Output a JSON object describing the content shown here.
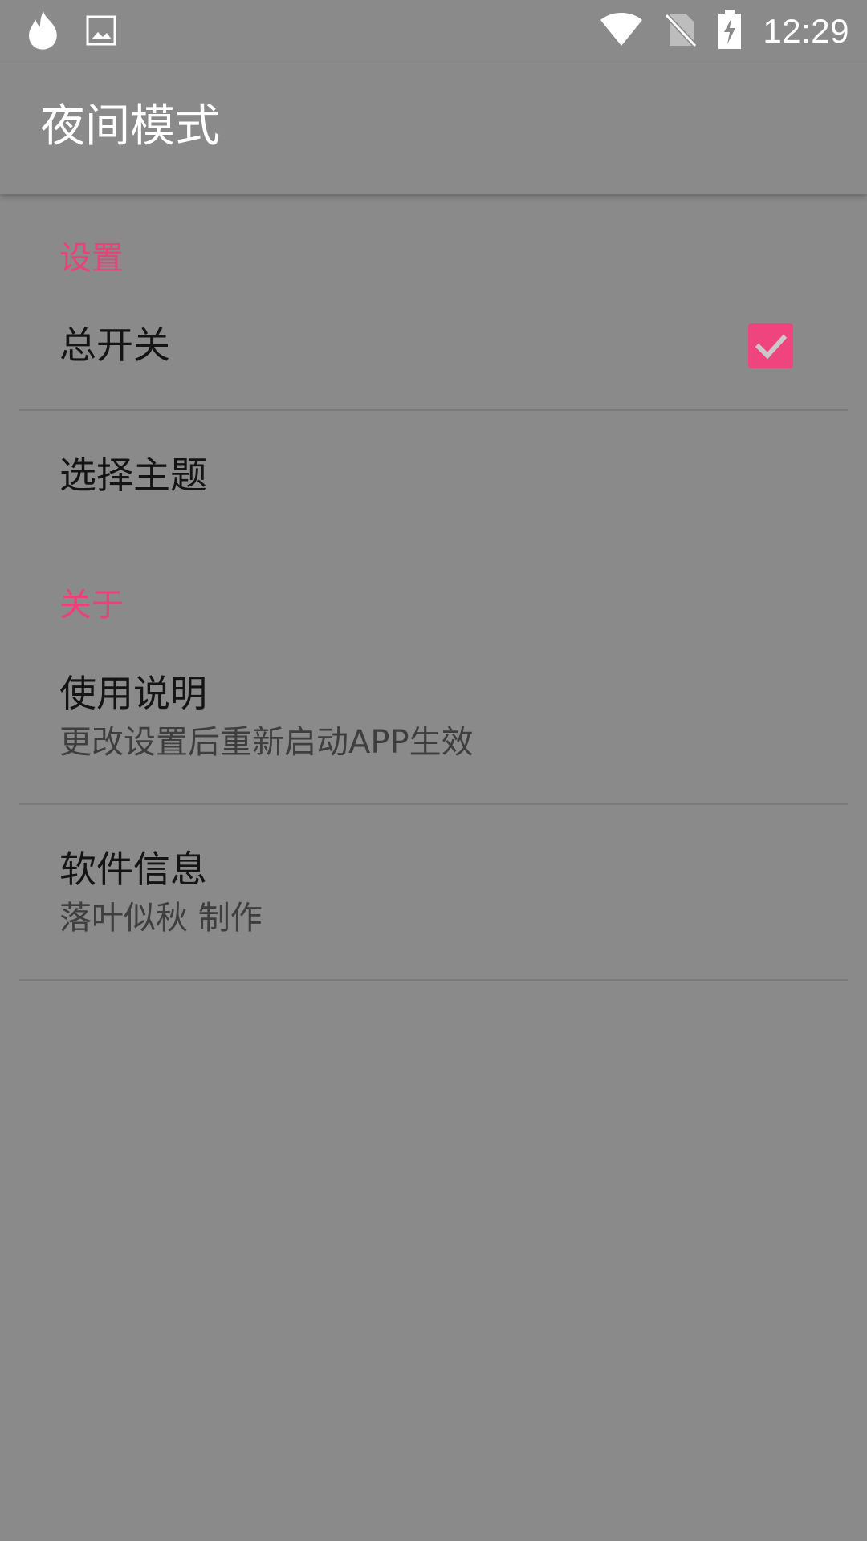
{
  "status_bar": {
    "time": "12:29",
    "left_icons": [
      "fire-icon",
      "image-icon"
    ],
    "right_icons": [
      "wifi-icon",
      "no-sim-icon",
      "battery-charging-icon"
    ]
  },
  "app_bar": {
    "title": "夜间模式"
  },
  "sections": [
    {
      "header": "设置",
      "items": [
        {
          "title": "总开关",
          "checked": true
        },
        {
          "title": "选择主题"
        }
      ]
    },
    {
      "header": "关于",
      "items": [
        {
          "title": "使用说明",
          "summary": "更改设置后重新启动APP生效"
        },
        {
          "title": "软件信息",
          "summary": "落叶似秋 制作"
        }
      ]
    }
  ],
  "colors": {
    "background": "#8a8a8a",
    "accent": "#e94279",
    "checkbox": "#f0447f",
    "title_text": "#141414",
    "summary_text": "#3e3e3e"
  }
}
